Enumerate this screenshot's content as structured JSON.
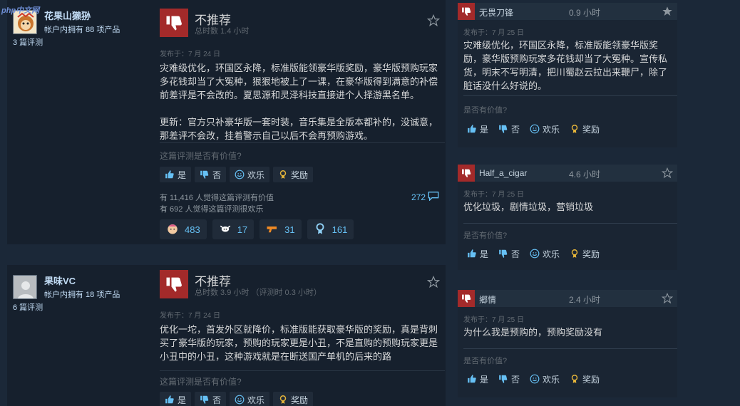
{
  "watermark": "php中文网",
  "reviews": [
    {
      "author": "花果山獭狲",
      "owned": "帐户内拥有 88 项产品",
      "review_count": "3 篇评测",
      "verdict": "不推荐",
      "hours": "总时数 1.4 小时",
      "posted": "发布于：7 月 24 日",
      "paragraphs": [
        "灾难级优化，环国区永降，标准版能领豪华版奖励，豪华版预购玩家多花钱却当了大冤种，狠狠地被上了一课，在豪华版得到满意的补偿前差评是不会改的。夏思源和灵泽科技直接进个人择游黑名单。",
        "更新：官方只补豪华版一套时装，音乐集是全版本都补的，没诚意，那差评不会改，挂着警示自己以后不会再预购游戏。"
      ],
      "helpful_q": "这篇评测是否有价值?",
      "btn_yes": "是",
      "btn_no": "否",
      "btn_funny": "欢乐",
      "btn_award": "奖励",
      "helpful_stat": "有 11,416 人觉得这篇评测有价值",
      "funny_stat": "有 692 人觉得这篇评测很欢乐",
      "comments": "272",
      "awards": [
        {
          "icon": "baby-face-icon",
          "count": "483"
        },
        {
          "icon": "cow-icon",
          "count": "17"
        },
        {
          "icon": "gun-icon",
          "count": "31"
        },
        {
          "icon": "medal-icon",
          "count": "161"
        }
      ]
    },
    {
      "author": "果味VC",
      "owned": "帐户内拥有 18 项产品",
      "review_count": "6 篇评测",
      "verdict": "不推荐",
      "hours": "总时数 3.9 小时  （评测时 0.3 小时）",
      "posted": "发布于：7 月 24 日",
      "paragraphs": [
        "优化一坨，首发外区就降价，标准版能获取豪华版的奖励，真是背刺买了豪华版的玩家，预购的玩家更是小丑，不是直购的预购玩家更是小丑中的小丑，这种游戏就是在断送国产单机的后来的路"
      ],
      "helpful_q": "这篇评测是否有价值?",
      "btn_yes": "是",
      "btn_no": "否",
      "btn_funny": "欢乐",
      "btn_award": "奖励"
    }
  ],
  "side_cards": [
    {
      "name": "无畏刀锋",
      "hours": "0.9 小时",
      "posted": "发布于：7 月 25 日",
      "text": "灾难级优化，环国区永降，标准版能领豪华版奖励，豪华版预购玩家多花钱却当了大冤种。宣传私货，明末不写明清，把川蜀赵云拉出来鞭尸，除了脏话没什么好说的。",
      "helpful_q": "是否有价值?",
      "btn_yes": "是",
      "btn_no": "否",
      "btn_funny": "欢乐",
      "btn_award": "奖励"
    },
    {
      "name": "Half_a_cigar",
      "hours": "4.6 小时",
      "posted": "发布于：7 月 25 日",
      "text": "优化垃圾，剧情垃圾，营销垃圾",
      "helpful_q": "是否有价值?",
      "btn_yes": "是",
      "btn_no": "否",
      "btn_funny": "欢乐",
      "btn_award": "奖励"
    },
    {
      "name": "郷情",
      "hours": "2.4 小时",
      "posted": "发布于：7 月 25 日",
      "text": "为什么我是预购的，预购奖励没有",
      "helpful_q": "是否有价值?",
      "btn_yes": "是",
      "btn_no": "否",
      "btn_funny": "欢乐",
      "btn_award": "奖励"
    }
  ],
  "colors": {
    "thumb_down": "#a32a2a",
    "link": "#66c0f4",
    "bg": "#1b2838"
  }
}
